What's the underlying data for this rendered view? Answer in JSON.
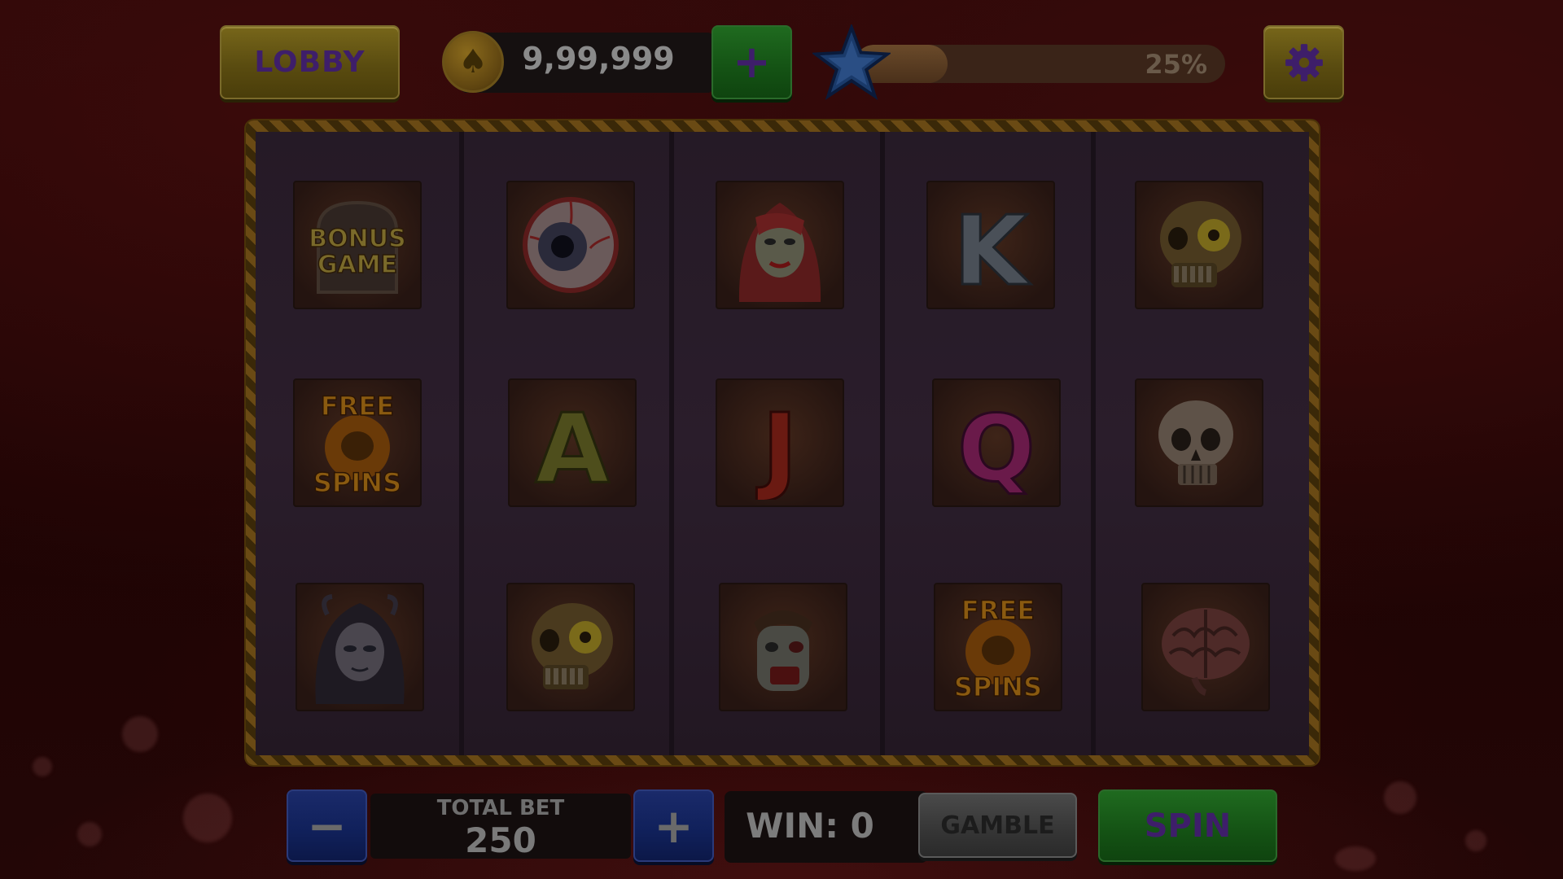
{
  "top_bar": {
    "lobby_label": "LOBBY",
    "coin_balance": "9,99,999",
    "add_coins_label": "+",
    "xp_progress_text": "25%",
    "xp_progress_fraction": 0.25
  },
  "reels": {
    "columns": 5,
    "rows": 3,
    "symbols": [
      [
        "bonus-game",
        "eyeball",
        "vampire-woman",
        "letter-k",
        "zombie-skull"
      ],
      [
        "free-spins",
        "letter-a",
        "letter-j",
        "letter-q",
        "skull"
      ],
      [
        "ghost-girl",
        "zombie-skull",
        "zombie-man",
        "free-spins",
        "brain"
      ]
    ],
    "bonus_text": [
      "BONUS",
      "GAME"
    ],
    "free_spins_text": [
      "FREE",
      "SPINS"
    ],
    "letters": {
      "k": "K",
      "a": "A",
      "j": "J",
      "q": "Q"
    }
  },
  "bottom_bar": {
    "minus_label": "−",
    "plus_label": "+",
    "total_bet_label": "TOTAL BET",
    "total_bet_value": "250",
    "win_text": "WIN: 0",
    "gamble_label": "GAMBLE",
    "spin_label": "SPIN"
  },
  "colors": {
    "gold": "#77661a",
    "green": "#1f6a1f",
    "blue": "#1a2a6a",
    "label_purple": "#3e1e6a"
  }
}
